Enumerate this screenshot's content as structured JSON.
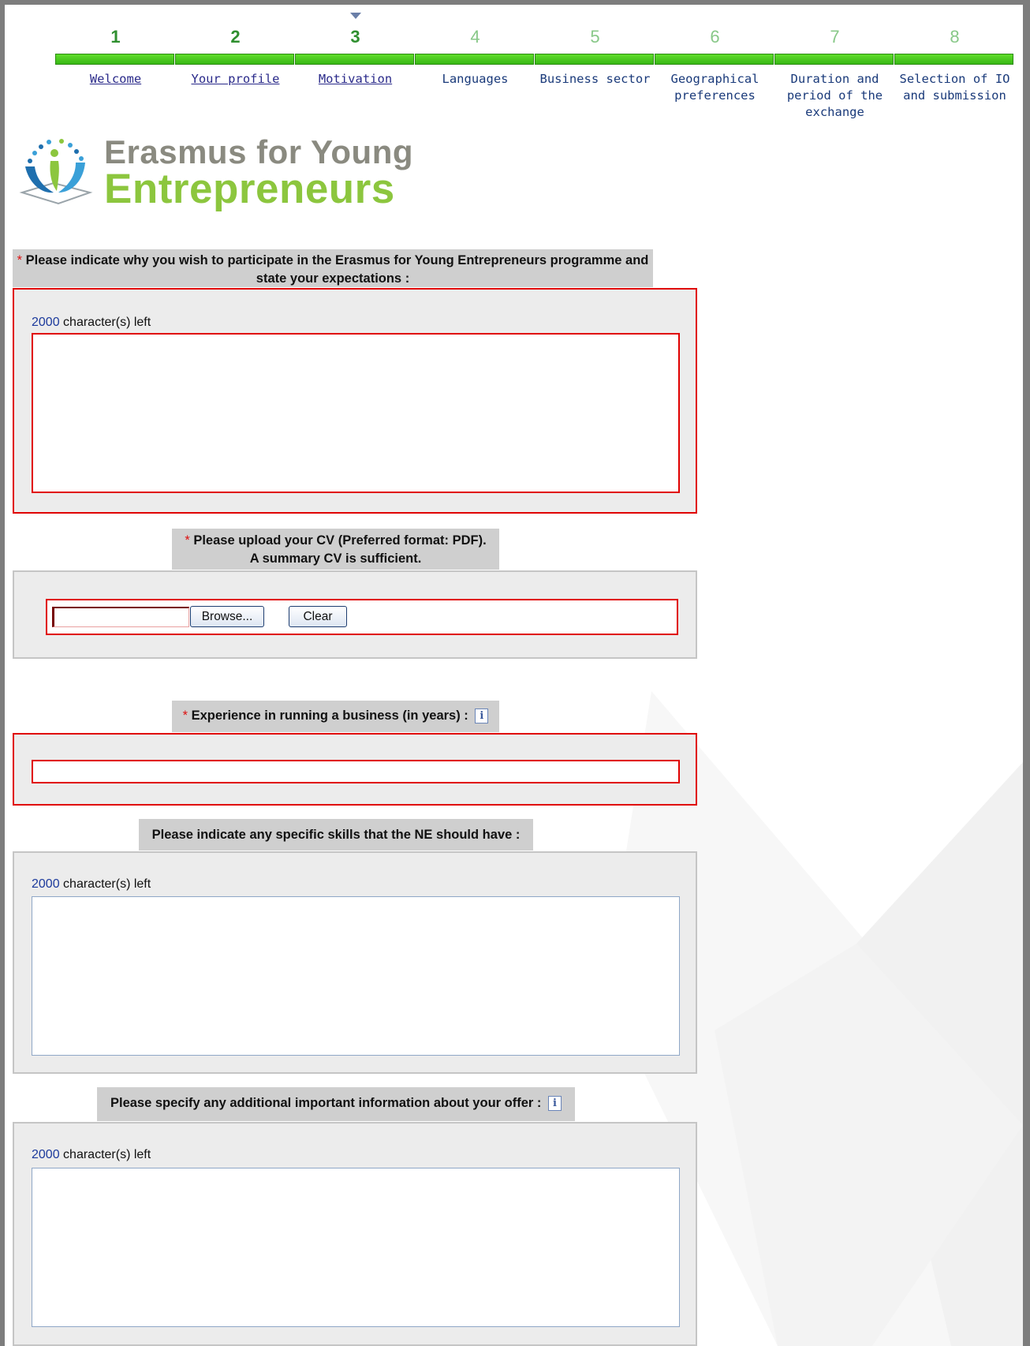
{
  "stepper": {
    "current_step": 3,
    "steps": [
      {
        "num": "1",
        "label": "Welcome",
        "status": "done"
      },
      {
        "num": "2",
        "label": "Your profile",
        "status": "done"
      },
      {
        "num": "3",
        "label": "Motivation",
        "status": "current"
      },
      {
        "num": "4",
        "label": "Languages",
        "status": "todo"
      },
      {
        "num": "5",
        "label": "Business sector",
        "status": "todo"
      },
      {
        "num": "6",
        "label": "Geographical preferences",
        "status": "todo"
      },
      {
        "num": "7",
        "label": "Duration and period of the exchange",
        "status": "todo"
      },
      {
        "num": "8",
        "label": "Selection of IO and submission",
        "status": "todo"
      }
    ]
  },
  "logo": {
    "line1": "Erasmus for Young",
    "line2": "Entrepreneurs"
  },
  "colors": {
    "error_border": "#e00000",
    "required_star": "#d11111",
    "section_header_bg": "#cfcfcf",
    "section_box_bg": "#ececec",
    "step_done": "#2f8f2f",
    "step_todo": "#88c888",
    "logo_green": "#8cc63e",
    "logo_gray": "#8a8a80"
  },
  "required_marker": "*",
  "sections": {
    "motivation": {
      "title": "Please indicate why you wish to participate in the Erasmus for Young Entrepreneurs programme and state your expectations :",
      "required": true,
      "chars_left": "2000",
      "chars_suffix": " character(s) left",
      "value": ""
    },
    "cv": {
      "title_line1": "Please upload your CV (Preferred format: PDF).",
      "title_line2": "A summary CV is sufficient.",
      "required": true,
      "file_value": "",
      "browse_label": "Browse...",
      "clear_label": "Clear"
    },
    "experience": {
      "title": "Experience in running a business (in years) :",
      "required": true,
      "info_icon": "i",
      "value": ""
    },
    "skills": {
      "title": "Please indicate any specific skills that the NE should have :",
      "required": false,
      "chars_left": "2000",
      "chars_suffix": " character(s) left",
      "value": ""
    },
    "additional": {
      "title": "Please specify any additional important information about your offer :",
      "required": false,
      "info_icon": "i",
      "chars_left": "2000",
      "chars_suffix": " character(s) left",
      "value": ""
    }
  }
}
